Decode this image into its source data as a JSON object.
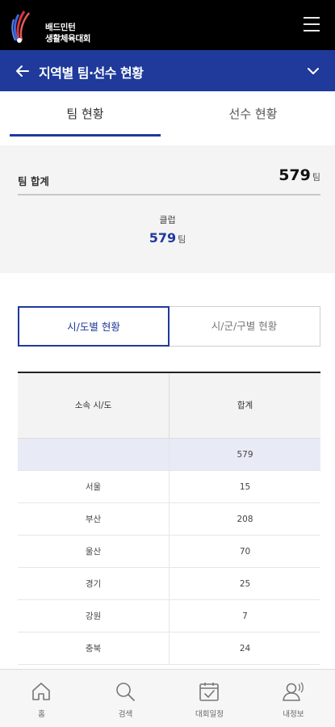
{
  "header": {
    "logo_line1": "배드민턴",
    "logo_line2": "생활체육대회"
  },
  "titlebar": {
    "title": "지역별 팀·선수 현황"
  },
  "tabs": [
    {
      "label": "팀 현황",
      "active": true
    },
    {
      "label": "선수 현황",
      "active": false
    }
  ],
  "summary": {
    "total_label": "팀 합계",
    "total_value": "579",
    "unit": "팀",
    "category_label": "클럽",
    "category_value": "579"
  },
  "segment": {
    "option_a": "시/도별 현황",
    "option_b": "시/군/구별 현황"
  },
  "table": {
    "headers": [
      "소속 시/도",
      "합계"
    ],
    "total_row": {
      "region": "",
      "value": "579"
    },
    "rows": [
      {
        "region": "서울",
        "value": "15"
      },
      {
        "region": "부산",
        "value": "208"
      },
      {
        "region": "울산",
        "value": "70"
      },
      {
        "region": "경기",
        "value": "25"
      },
      {
        "region": "강원",
        "value": "7"
      },
      {
        "region": "충북",
        "value": "24"
      }
    ]
  },
  "bottom_nav": [
    {
      "label": "홈",
      "icon": "home-icon"
    },
    {
      "label": "검색",
      "icon": "search-icon"
    },
    {
      "label": "대회일정",
      "icon": "calendar-icon"
    },
    {
      "label": "내정보",
      "icon": "user-icon"
    }
  ],
  "colors": {
    "brand_blue": "#1f3a9b",
    "header_black": "#000000"
  }
}
